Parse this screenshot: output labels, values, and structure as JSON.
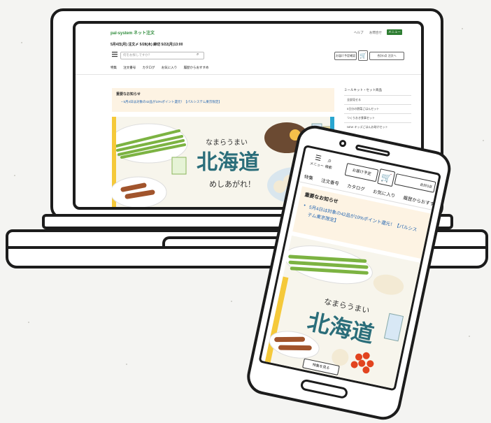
{
  "site": {
    "logo": "pal-system ネット注文",
    "help_label": "ヘルプ",
    "login_label": "お問合せ",
    "menu_label": "メニュー"
  },
  "laptop": {
    "delivery_date": "5月4日(月) 注文〆 5/28(木)  締切 5/22(月)13:00",
    "search_placeholder": "何をお探しですか？",
    "btn_delivery": "お届け予定確認",
    "btn_order": "合計0点 注文へ",
    "nav": [
      "特集",
      "注文番号",
      "カタログ",
      "お気に入り",
      "履歴からおすすめ"
    ],
    "notice_title": "重要なお知らせ",
    "notice_text": "・5月4日は対象の42品が10%ポイント還元！【パルシステム東京限定】",
    "sidebar_title": "ミールキット・セット商品",
    "sidebar_items": [
      "全部見せる",
      "5日分の野菜ごはんセット",
      "つくりおき食事セット",
      "NEW キッズごはんお助けセット"
    ]
  },
  "phone": {
    "menu_label": "メニュー",
    "search_label": "検索",
    "btn_delivery": "お届け予定",
    "btn_order": "合計0点",
    "nav": [
      "特集",
      "注文番号",
      "カタログ",
      "お気に入り",
      "履歴からおすすめ"
    ],
    "notice_title": "重要なお知らせ",
    "notice_text": "5月4日は対象の42品が10%ポイント還元！【パルシステム東京限定】",
    "see_button": "特集を見る"
  },
  "banner": {
    "headline": "北海道",
    "catchphrase": "なまらうまい",
    "subline": "めしあがれ！"
  },
  "colors": {
    "brand_green": "#2e7d32",
    "link_blue": "#2264b0",
    "notice_bg": "#fdf3e3",
    "outline": "#1c1c1c"
  }
}
